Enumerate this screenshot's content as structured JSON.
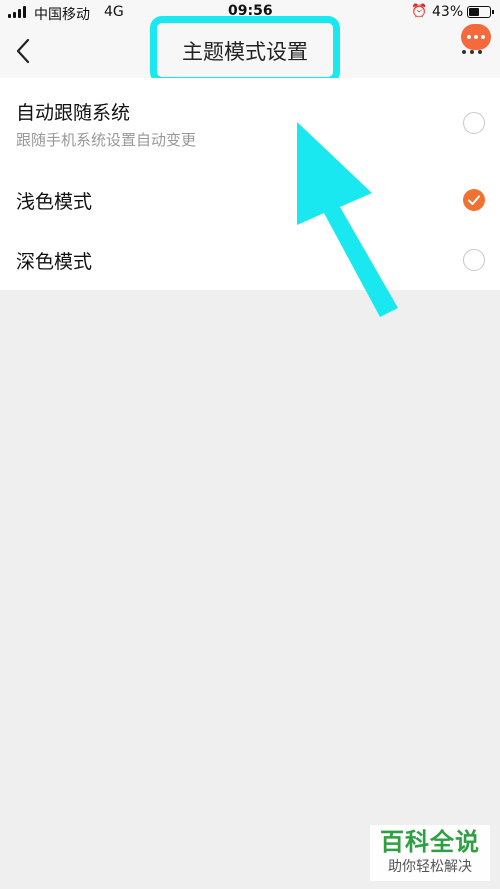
{
  "status_bar": {
    "carrier": "中国移动",
    "network": "4G",
    "time": "09:56",
    "battery_percent": "43%"
  },
  "nav": {
    "title": "主题模式设置",
    "back_icon": "chevron-left-icon",
    "more_icon": "ellipsis-icon"
  },
  "options": [
    {
      "label": "自动跟随系统",
      "sublabel": "跟随手机系统设置自动变更",
      "checked": false
    },
    {
      "label": "浅色模式",
      "checked": true
    },
    {
      "label": "深色模式",
      "checked": false
    }
  ],
  "watermark": {
    "title": "百科全说",
    "subtitle": "助你轻松解决"
  },
  "colors": {
    "accent": "#ee7333",
    "highlight": "#19e8f0",
    "watermark_green": "#2ea043"
  }
}
